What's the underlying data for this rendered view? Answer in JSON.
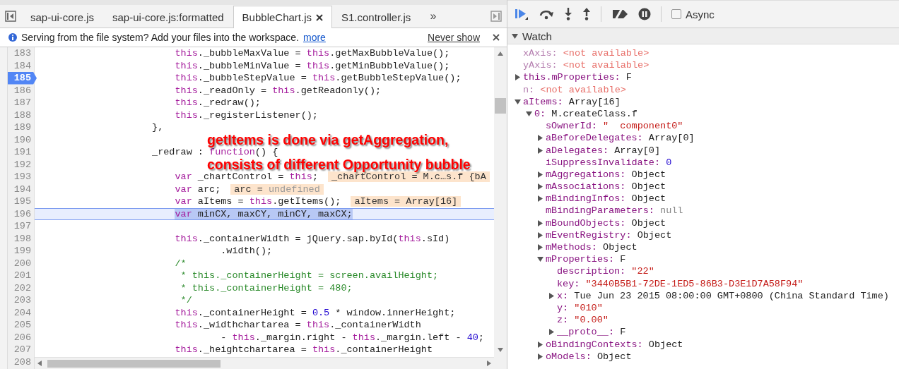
{
  "editor_tabs": [
    {
      "label": "sap-ui-core.js",
      "selected": false
    },
    {
      "label": "sap-ui-core.js:formatted",
      "selected": false
    },
    {
      "label": "BubbleChart.js",
      "selected": true
    },
    {
      "label": "S1.controller.js",
      "selected": false
    }
  ],
  "tabs_overflow": "»",
  "infobar": {
    "message": "Serving from the file system? Add your files into the workspace.",
    "link": "more",
    "dismiss": "Never show"
  },
  "code_lines": [
    {
      "n": "183",
      "breakpoint": false,
      "current": false,
      "code": [
        {
          "kind": "keyword",
          "text": "                        this"
        },
        {
          "kind": "plain",
          "text": "._bubbleMaxValue = "
        },
        {
          "kind": "keyword",
          "text": "this"
        },
        {
          "kind": "plain",
          "text": ".getMaxBubbleValue();"
        }
      ]
    },
    {
      "n": "184",
      "breakpoint": false,
      "current": false,
      "code": [
        {
          "kind": "keyword",
          "text": "                        this"
        },
        {
          "kind": "plain",
          "text": "._bubbleMinValue = "
        },
        {
          "kind": "keyword",
          "text": "this"
        },
        {
          "kind": "plain",
          "text": ".getMinBubbleValue();"
        }
      ]
    },
    {
      "n": "185",
      "breakpoint": true,
      "current": false,
      "code": [
        {
          "kind": "keyword",
          "text": "                        this"
        },
        {
          "kind": "plain",
          "text": "._bubbleStepValue = "
        },
        {
          "kind": "keyword",
          "text": "this"
        },
        {
          "kind": "plain",
          "text": ".getBubbleStepValue();"
        }
      ]
    },
    {
      "n": "186",
      "breakpoint": false,
      "current": false,
      "code": [
        {
          "kind": "keyword",
          "text": "                        this"
        },
        {
          "kind": "plain",
          "text": "._readOnly = "
        },
        {
          "kind": "keyword",
          "text": "this"
        },
        {
          "kind": "plain",
          "text": ".getReadonly();"
        }
      ]
    },
    {
      "n": "187",
      "breakpoint": false,
      "current": false,
      "code": [
        {
          "kind": "keyword",
          "text": "                        this"
        },
        {
          "kind": "plain",
          "text": "._redraw();"
        }
      ]
    },
    {
      "n": "188",
      "breakpoint": false,
      "current": false,
      "code": [
        {
          "kind": "keyword",
          "text": "                        this"
        },
        {
          "kind": "plain",
          "text": "._registerListener();"
        }
      ]
    },
    {
      "n": "189",
      "breakpoint": false,
      "current": false,
      "code": [
        {
          "kind": "plain",
          "text": "                    },"
        }
      ]
    },
    {
      "n": "190",
      "breakpoint": false,
      "current": false
    },
    {
      "n": "191",
      "breakpoint": false,
      "current": false,
      "code": [
        {
          "kind": "plain",
          "text": "                    _redraw : "
        },
        {
          "kind": "keyword",
          "text": "function"
        },
        {
          "kind": "plain",
          "text": "() {"
        }
      ]
    },
    {
      "n": "192",
      "breakpoint": false,
      "current": false
    },
    {
      "n": "193",
      "breakpoint": false,
      "current": false,
      "code": [
        {
          "kind": "keyword",
          "text": "                        var"
        },
        {
          "kind": "plain",
          "text": " _chartControl = "
        },
        {
          "kind": "keyword",
          "text": "this"
        },
        {
          "kind": "plain",
          "text": ";"
        }
      ],
      "hint": [
        {
          "kind": "plain",
          "text": "_chartControl = M.c…s.f {bA"
        }
      ]
    },
    {
      "n": "194",
      "breakpoint": false,
      "current": false,
      "code": [
        {
          "kind": "keyword",
          "text": "                        var"
        },
        {
          "kind": "plain",
          "text": " arc;"
        }
      ],
      "hint": [
        {
          "kind": "plain",
          "text": "arc = "
        },
        {
          "kind": "undef",
          "text": "undefined"
        }
      ]
    },
    {
      "n": "195",
      "breakpoint": false,
      "current": false,
      "code": [
        {
          "kind": "keyword",
          "text": "                        var"
        },
        {
          "kind": "plain",
          "text": " aItems = "
        },
        {
          "kind": "keyword",
          "text": "this"
        },
        {
          "kind": "plain",
          "text": ".getItems();"
        }
      ],
      "hint": [
        {
          "kind": "plain",
          "text": "aItems = Array[16]"
        }
      ]
    },
    {
      "n": "196",
      "breakpoint": false,
      "current": true,
      "code": [
        {
          "kind": "keyword",
          "text": "                        var"
        },
        {
          "kind": "plain",
          "text": " minCX, maxCY, minCY, maxCX;"
        }
      ]
    },
    {
      "n": "197",
      "breakpoint": false,
      "current": false
    },
    {
      "n": "198",
      "breakpoint": false,
      "current": false,
      "code": [
        {
          "kind": "keyword",
          "text": "                        this"
        },
        {
          "kind": "plain",
          "text": "._containerWidth = jQuery.sap.byId("
        },
        {
          "kind": "keyword",
          "text": "this"
        },
        {
          "kind": "plain",
          "text": ".sId)"
        }
      ]
    },
    {
      "n": "199",
      "breakpoint": false,
      "current": false,
      "code": [
        {
          "kind": "plain",
          "text": "                                .width();"
        }
      ]
    },
    {
      "n": "200",
      "breakpoint": false,
      "current": false,
      "code": [
        {
          "kind": "comment",
          "text": "                        /*"
        }
      ]
    },
    {
      "n": "201",
      "breakpoint": false,
      "current": false,
      "code": [
        {
          "kind": "comment",
          "text": "                         * this._containerHeight = screen.availHeight;"
        }
      ]
    },
    {
      "n": "202",
      "breakpoint": false,
      "current": false,
      "code": [
        {
          "kind": "comment",
          "text": "                         * this._containerHeight = 480;"
        }
      ]
    },
    {
      "n": "203",
      "breakpoint": false,
      "current": false,
      "code": [
        {
          "kind": "comment",
          "text": "                         */"
        }
      ]
    },
    {
      "n": "204",
      "breakpoint": false,
      "current": false,
      "code": [
        {
          "kind": "keyword",
          "text": "                        this"
        },
        {
          "kind": "plain",
          "text": "._containerHeight = "
        },
        {
          "kind": "number",
          "text": "0.5"
        },
        {
          "kind": "plain",
          "text": " * window.innerHeight;"
        }
      ]
    },
    {
      "n": "205",
      "breakpoint": false,
      "current": false,
      "code": [
        {
          "kind": "keyword",
          "text": "                        this"
        },
        {
          "kind": "plain",
          "text": "._widthchartarea = "
        },
        {
          "kind": "keyword",
          "text": "this"
        },
        {
          "kind": "plain",
          "text": "._containerWidth"
        }
      ]
    },
    {
      "n": "206",
      "breakpoint": false,
      "current": false,
      "code": [
        {
          "kind": "plain",
          "text": "                                - "
        },
        {
          "kind": "keyword",
          "text": "this"
        },
        {
          "kind": "plain",
          "text": "._margin.right - "
        },
        {
          "kind": "keyword",
          "text": "this"
        },
        {
          "kind": "plain",
          "text": "._margin.left - "
        },
        {
          "kind": "number",
          "text": "40"
        },
        {
          "kind": "plain",
          "text": ";"
        }
      ]
    },
    {
      "n": "207",
      "breakpoint": false,
      "current": false,
      "code": [
        {
          "kind": "keyword",
          "text": "                        this"
        },
        {
          "kind": "plain",
          "text": "._heightchartarea = "
        },
        {
          "kind": "keyword",
          "text": "this"
        },
        {
          "kind": "plain",
          "text": "._containerHeight"
        }
      ]
    },
    {
      "n": "208",
      "breakpoint": false,
      "current": false
    }
  ],
  "annotation": [
    "getItems is done via getAggregation,",
    "consists of different Opportunity bubble"
  ],
  "debugger_toolbar": {
    "async": {
      "label": "Async",
      "checked": false
    }
  },
  "watch": {
    "title": "Watch",
    "expanded": true,
    "items": [
      {
        "name": "xAxis:",
        "value": "<not available>",
        "kind": "unavailable"
      },
      {
        "name": "yAxis:",
        "value": "<not available>",
        "kind": "unavailable"
      },
      {
        "name": "this.mProperties:",
        "value": "F",
        "kind": "object",
        "expanded": false
      },
      {
        "name": "n:",
        "value": "<not available>",
        "kind": "unavailable"
      },
      {
        "name": "aItems:",
        "value": "Array[16]",
        "kind": "object",
        "expanded": true,
        "children": [
          {
            "name": "0:",
            "value": "M.createClass.f",
            "kind": "object",
            "expanded": true,
            "children": [
              {
                "name": "sOwnerId:",
                "value": "\"  component0\"",
                "kind": "string"
              },
              {
                "name": "aBeforeDelegates:",
                "value": "Array[0]",
                "kind": "object",
                "expanded": false
              },
              {
                "name": "aDelegates:",
                "value": "Array[0]",
                "kind": "object",
                "expanded": false
              },
              {
                "name": "iSuppressInvalidate:",
                "value": "0",
                "kind": "number"
              },
              {
                "name": "mAggregations:",
                "value": "Object",
                "kind": "object",
                "expanded": false
              },
              {
                "name": "mAssociations:",
                "value": "Object",
                "kind": "object",
                "expanded": false
              },
              {
                "name": "mBindingInfos:",
                "value": "Object",
                "kind": "object",
                "expanded": false
              },
              {
                "name": "mBindingParameters:",
                "value": "null",
                "kind": "null"
              },
              {
                "name": "mBoundObjects:",
                "value": "Object",
                "kind": "object",
                "expanded": false
              },
              {
                "name": "mEventRegistry:",
                "value": "Object",
                "kind": "object",
                "expanded": false
              },
              {
                "name": "mMethods:",
                "value": "Object",
                "kind": "object",
                "expanded": false
              },
              {
                "name": "mProperties:",
                "value": "F",
                "kind": "object",
                "expanded": true,
                "children": [
                  {
                    "name": "description:",
                    "value": "\"22\"",
                    "kind": "string"
                  },
                  {
                    "name": "key:",
                    "value": "\"3440B5B1-72DE-1ED5-86B3-D3E1D7A58F94\"",
                    "kind": "string"
                  },
                  {
                    "name": "x:",
                    "value": "Tue Jun 23 2015 08:00:00 GMT+0800 (China Standard Time)",
                    "kind": "object",
                    "expanded": false
                  },
                  {
                    "name": "y:",
                    "value": "\"010\"",
                    "kind": "string"
                  },
                  {
                    "name": "z:",
                    "value": "\"0.00\"",
                    "kind": "string"
                  },
                  {
                    "name": "__proto__:",
                    "value": "F",
                    "kind": "object",
                    "expanded": false
                  }
                ]
              },
              {
                "name": "oBindingContexts:",
                "value": "Object",
                "kind": "object",
                "expanded": false
              },
              {
                "name": "oModels:",
                "value": "Object",
                "kind": "object",
                "expanded": false
              }
            ]
          }
        ]
      }
    ]
  }
}
